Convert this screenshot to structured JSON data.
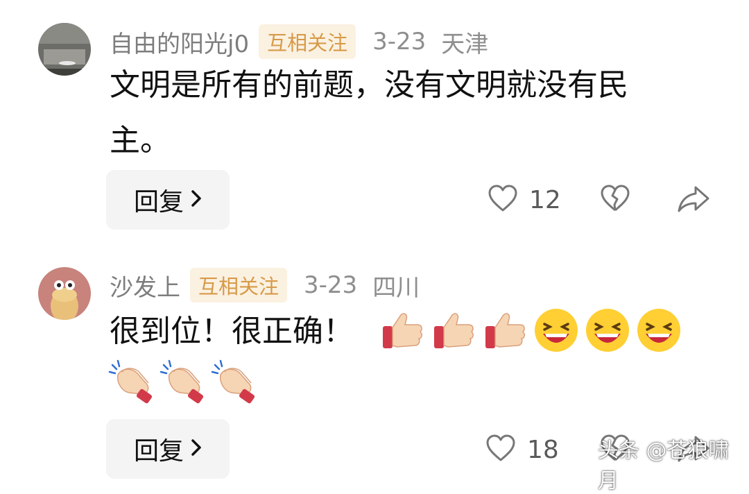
{
  "comments": [
    {
      "username": "自由的阳光j0",
      "badge": "互相关注",
      "date": "3-23",
      "location": "天津",
      "text_line1": "文明是所有的前题，没有文明就没有民",
      "text_line2": "主。",
      "reply_label": "回复",
      "like_count": "12"
    },
    {
      "username": "沙发上",
      "badge": "互相关注",
      "date": "3-23",
      "location": "四川",
      "text": "很到位！很正确！",
      "emojis_line1": [
        "thumbs-up-icon",
        "thumbs-up-icon",
        "thumbs-up-icon",
        "laughing-face-icon",
        "laughing-face-icon",
        "laughing-face-icon"
      ],
      "emojis_line2": [
        "clapping-hands-icon",
        "clapping-hands-icon",
        "clapping-hands-icon"
      ],
      "reply_label": "回复",
      "like_count": "18"
    }
  ],
  "watermark": "头条 @苍狼啸月",
  "colors": {
    "badge_bg": "#fbf1e1",
    "badge_text": "#d69a48",
    "button_bg": "#f4f4f4",
    "meta_text": "#8e8e8e"
  }
}
